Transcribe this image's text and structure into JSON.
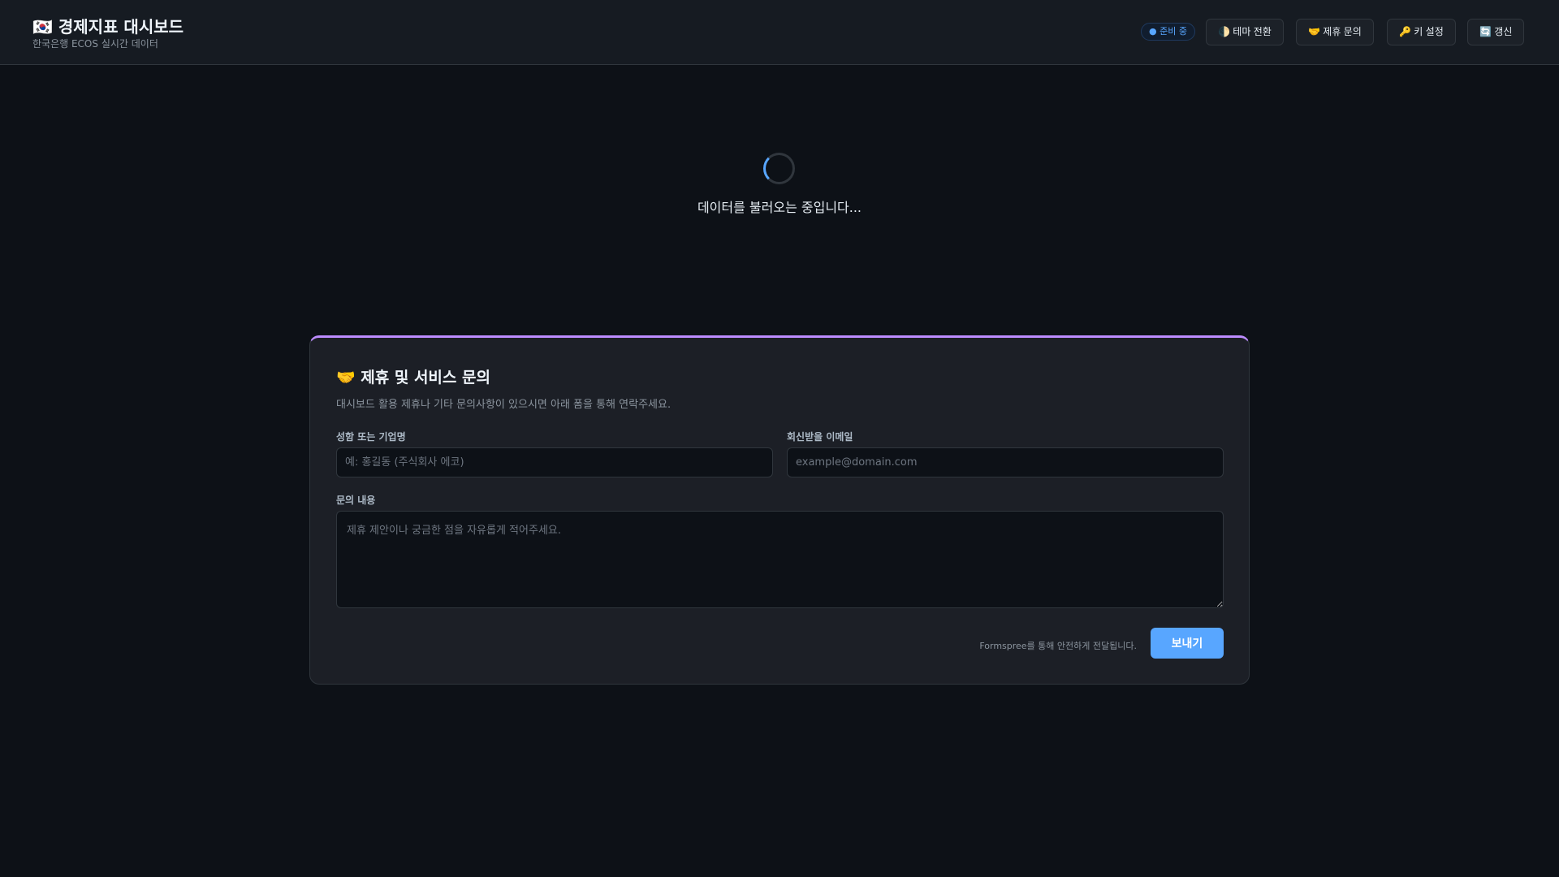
{
  "header": {
    "title": "🇰🇷 경제지표 대시보드",
    "subtitle": "한국은행 ECOS 실시간 데이터",
    "status_badge": "● 준비 중",
    "buttons": {
      "theme": "🌓 테마 전환",
      "partner": "🤝 제휴 문의",
      "key": "🔑 키 설정",
      "refresh": "🔄 갱신"
    }
  },
  "loading": {
    "text": "데이터를 불러오는 중입니다..."
  },
  "contact": {
    "title": "🤝 제휴 및 서비스 문의",
    "description": "대시보드 활용 제휴나 기타 문의사항이 있으시면 아래 폼을 통해 연락주세요.",
    "name_label": "성함 또는 기업명",
    "name_placeholder": "예: 홍길동 (주식회사 에코)",
    "email_label": "회신받을 이메일",
    "email_placeholder": "example@domain.com",
    "message_label": "문의 내용",
    "message_placeholder": "제휴 제안이나 궁금한 점을 자유롭게 적어주세요.",
    "note": "Formspree를 통해 안전하게 전달됩니다.",
    "submit": "보내기"
  },
  "colors": {
    "accent": "#58a6ff",
    "card_top": "#bc8cff"
  }
}
